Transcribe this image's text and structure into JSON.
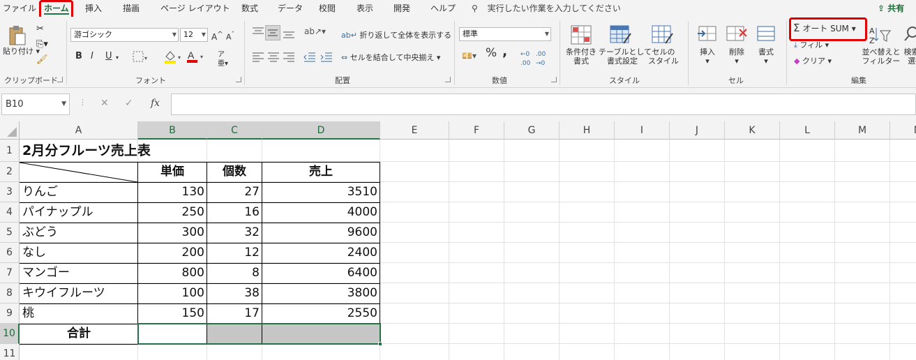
{
  "tabs": [
    "ファイル",
    "ホーム",
    "挿入",
    "描画",
    "ページ レイアウト",
    "数式",
    "データ",
    "校閲",
    "表示",
    "開発",
    "ヘルプ"
  ],
  "search_placeholder": "実行したい作業を入力してください",
  "share": "共有",
  "clipboard": {
    "paste": "貼り付け",
    "group": "クリップボード"
  },
  "font": {
    "name": "游ゴシック",
    "size": "12",
    "bold": "B",
    "italic": "I",
    "underline": "U",
    "group": "フォント"
  },
  "align": {
    "wrap": "折り返して全体を表示する",
    "merge": "セルを結合して中央揃え",
    "group": "配置"
  },
  "number": {
    "format": "標準",
    "percent": "%",
    "comma": ",",
    "group": "数値"
  },
  "styles": {
    "conditional": "条件付き\n書式",
    "table": "テーブルとして\n書式設定",
    "cell": "セルの\nスタイル",
    "group": "スタイル"
  },
  "cells": {
    "insert": "挿入",
    "delete": "削除",
    "format": "書式",
    "group": "セル"
  },
  "editing": {
    "autosum": "オート SUM",
    "fill": "フィル",
    "clear": "クリア",
    "sort": "並べ替えと\nフィルター",
    "find": "検索と\n選択",
    "group": "編集"
  },
  "namebox": "B10",
  "columns": [
    "A",
    "B",
    "C",
    "D",
    "E",
    "F",
    "G",
    "H",
    "I",
    "J",
    "K",
    "L",
    "M",
    "N"
  ],
  "rows": [
    "1",
    "2",
    "3",
    "4",
    "5",
    "6",
    "7",
    "8",
    "9",
    "10",
    "11"
  ],
  "sheet": {
    "title": "2月分フルーツ売上表",
    "headers": [
      "単価",
      "個数",
      "売上"
    ],
    "items": [
      {
        "name": "りんご",
        "price": "130",
        "qty": "27",
        "sales": "3510"
      },
      {
        "name": "パイナップル",
        "price": "250",
        "qty": "16",
        "sales": "4000"
      },
      {
        "name": "ぶどう",
        "price": "300",
        "qty": "32",
        "sales": "9600"
      },
      {
        "name": "なし",
        "price": "200",
        "qty": "12",
        "sales": "2400"
      },
      {
        "name": "マンゴー",
        "price": "800",
        "qty": "8",
        "sales": "6400"
      },
      {
        "name": "キウイフルーツ",
        "price": "100",
        "qty": "38",
        "sales": "3800"
      },
      {
        "name": "桃",
        "price": "150",
        "qty": "17",
        "sales": "2550"
      }
    ],
    "total_label": "合計"
  },
  "colors": {
    "accent": "#217346",
    "highlight": "#e00000"
  }
}
